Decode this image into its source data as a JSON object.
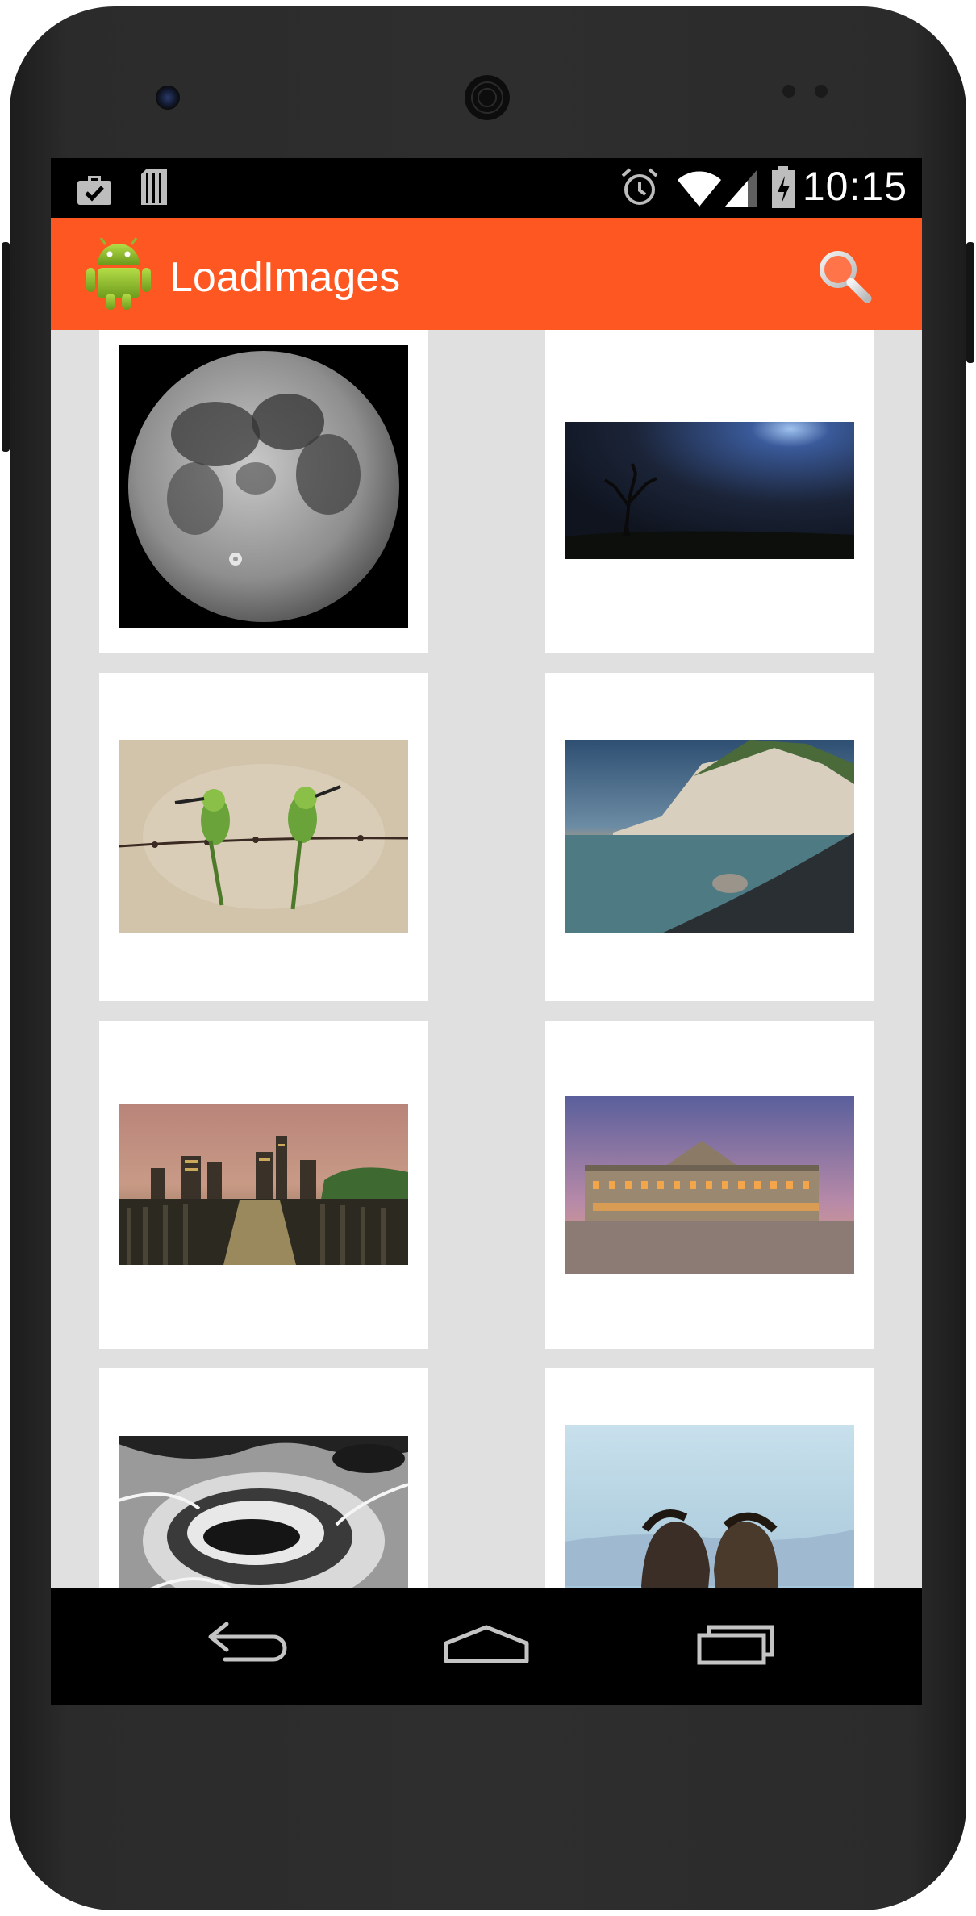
{
  "status_bar": {
    "time": "10:15",
    "left_icons": [
      "briefcase-check-icon",
      "sd-card-icon"
    ],
    "right_icons": [
      "alarm-icon",
      "wifi-icon",
      "cell-signal-icon",
      "battery-charging-icon"
    ]
  },
  "app_bar": {
    "title": "LoadImages",
    "logo_icon": "android-robot-icon",
    "action_icon": "search-icon",
    "color": "#ff5722"
  },
  "grid": {
    "background": "#e0e0e0",
    "card_color": "#ffffff",
    "photos": [
      {
        "subject": "full moon"
      },
      {
        "subject": "lone tree under night sky"
      },
      {
        "subject": "two green bee-eaters on barbed wire"
      },
      {
        "subject": "white cliffs by the sea at sunset"
      },
      {
        "subject": "city skyline across pier posts"
      },
      {
        "subject": "palace facade at dusk"
      },
      {
        "subject": "black and white waves over rocks"
      },
      {
        "subject": "two ponies in the snow"
      }
    ]
  },
  "nav_bar": {
    "buttons": [
      "back-icon",
      "home-icon",
      "recent-apps-icon"
    ]
  }
}
